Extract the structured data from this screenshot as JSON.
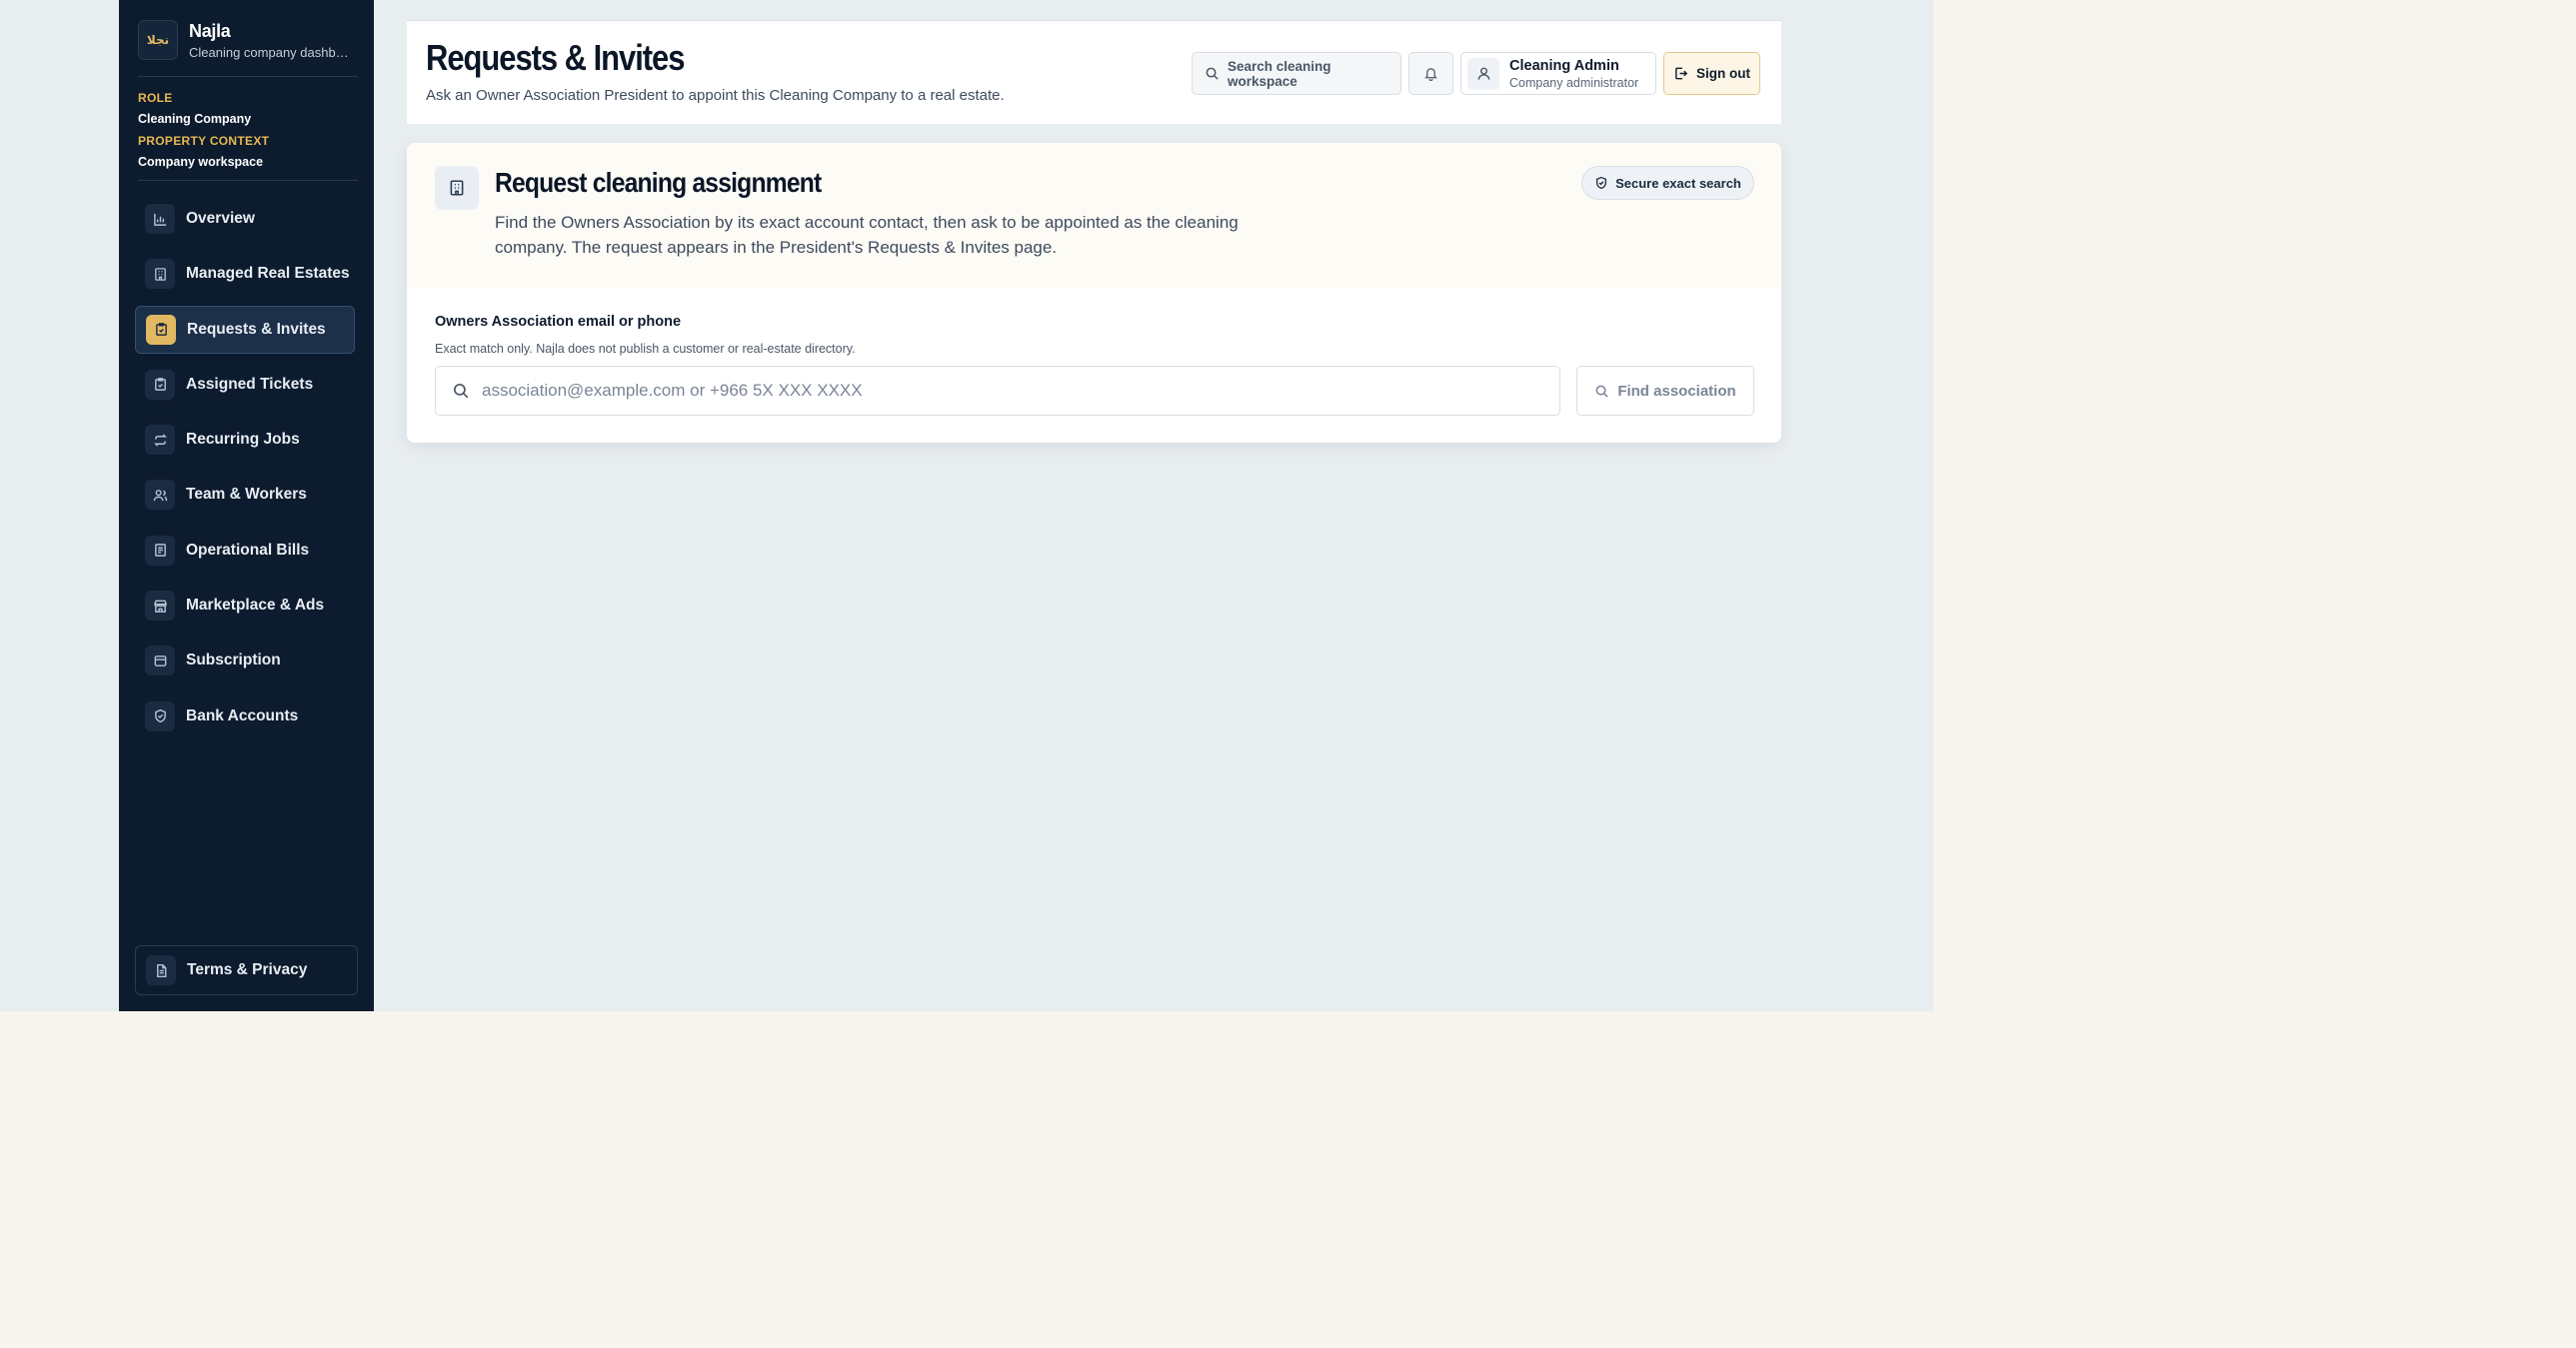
{
  "sidebar": {
    "brand": {
      "name": "Najla",
      "subtitle": "Cleaning company dashboard",
      "logo_text": "نجلا"
    },
    "role_label": "ROLE",
    "role_value": "Cleaning Company",
    "context_label": "PROPERTY CONTEXT",
    "context_value": "Company workspace",
    "items": [
      {
        "label": "Overview",
        "icon": "bar-chart-icon"
      },
      {
        "label": "Managed Real Estates",
        "icon": "building-icon"
      },
      {
        "label": "Requests & Invites",
        "icon": "clipboard-check-icon",
        "active": true
      },
      {
        "label": "Assigned Tickets",
        "icon": "clipboard-check-icon"
      },
      {
        "label": "Recurring Jobs",
        "icon": "repeat-icon"
      },
      {
        "label": "Team & Workers",
        "icon": "users-icon"
      },
      {
        "label": "Operational Bills",
        "icon": "receipt-icon"
      },
      {
        "label": "Marketplace & Ads",
        "icon": "store-icon"
      },
      {
        "label": "Subscription",
        "icon": "wallet-icon"
      },
      {
        "label": "Bank Accounts",
        "icon": "shield-icon"
      }
    ],
    "footer": {
      "label": "Terms & Privacy",
      "icon": "document-icon"
    }
  },
  "header": {
    "title": "Requests & Invites",
    "subtitle": "Ask an Owner Association President to appoint this Cleaning Company to a real estate.",
    "search_placeholder": "Search cleaning workspace",
    "user": {
      "name": "Cleaning Admin",
      "role": "Company administrator"
    },
    "sign_out": "Sign out"
  },
  "card": {
    "title": "Request cleaning assignment",
    "description": "Find the Owners Association by its exact account contact, then ask to be appointed as the cleaning company. The request appears in the President's Requests & Invites page.",
    "badge": "Secure exact search",
    "field_label": "Owners Association email or phone",
    "field_help": "Exact match only. Najla does not publish a customer or real-estate directory.",
    "field_placeholder": "association@example.com or +966 5X XXX XXXX",
    "field_value": "",
    "button": "Find association"
  },
  "colors": {
    "sidebar_bg": "#0d1b2e",
    "accent_gold": "#e2b862",
    "page_bg": "#e8edf0",
    "canvas_bg": "#f8f5ef"
  }
}
